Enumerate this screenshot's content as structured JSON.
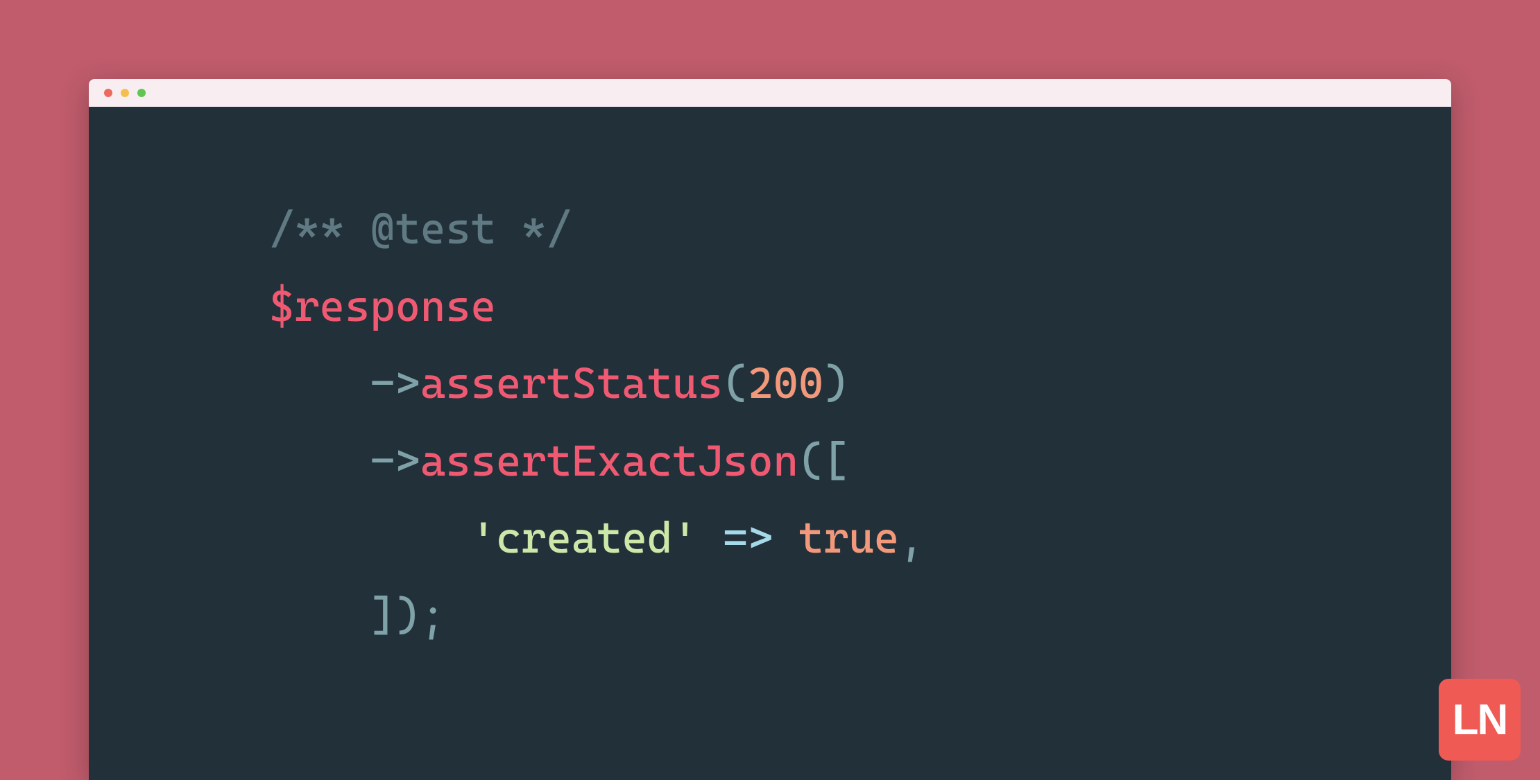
{
  "code": {
    "line1": {
      "comment": "/** @test */"
    },
    "line2": {
      "variable": "$response"
    },
    "line3": {
      "indent": "    ",
      "arrow": "->",
      "method": "assertStatus",
      "open": "(",
      "num": "200",
      "close": ")"
    },
    "line4": {
      "indent": "    ",
      "arrow": "->",
      "method": "assertExactJson",
      "open": "(["
    },
    "line5": {
      "indent": "        ",
      "string": "'created'",
      "space1": " ",
      "fatarrow": "=>",
      "space2": " ",
      "bool": "true",
      "comma": ","
    },
    "line6": {
      "indent": "    ",
      "close": "]);"
    }
  },
  "logo": {
    "text": "LN"
  }
}
